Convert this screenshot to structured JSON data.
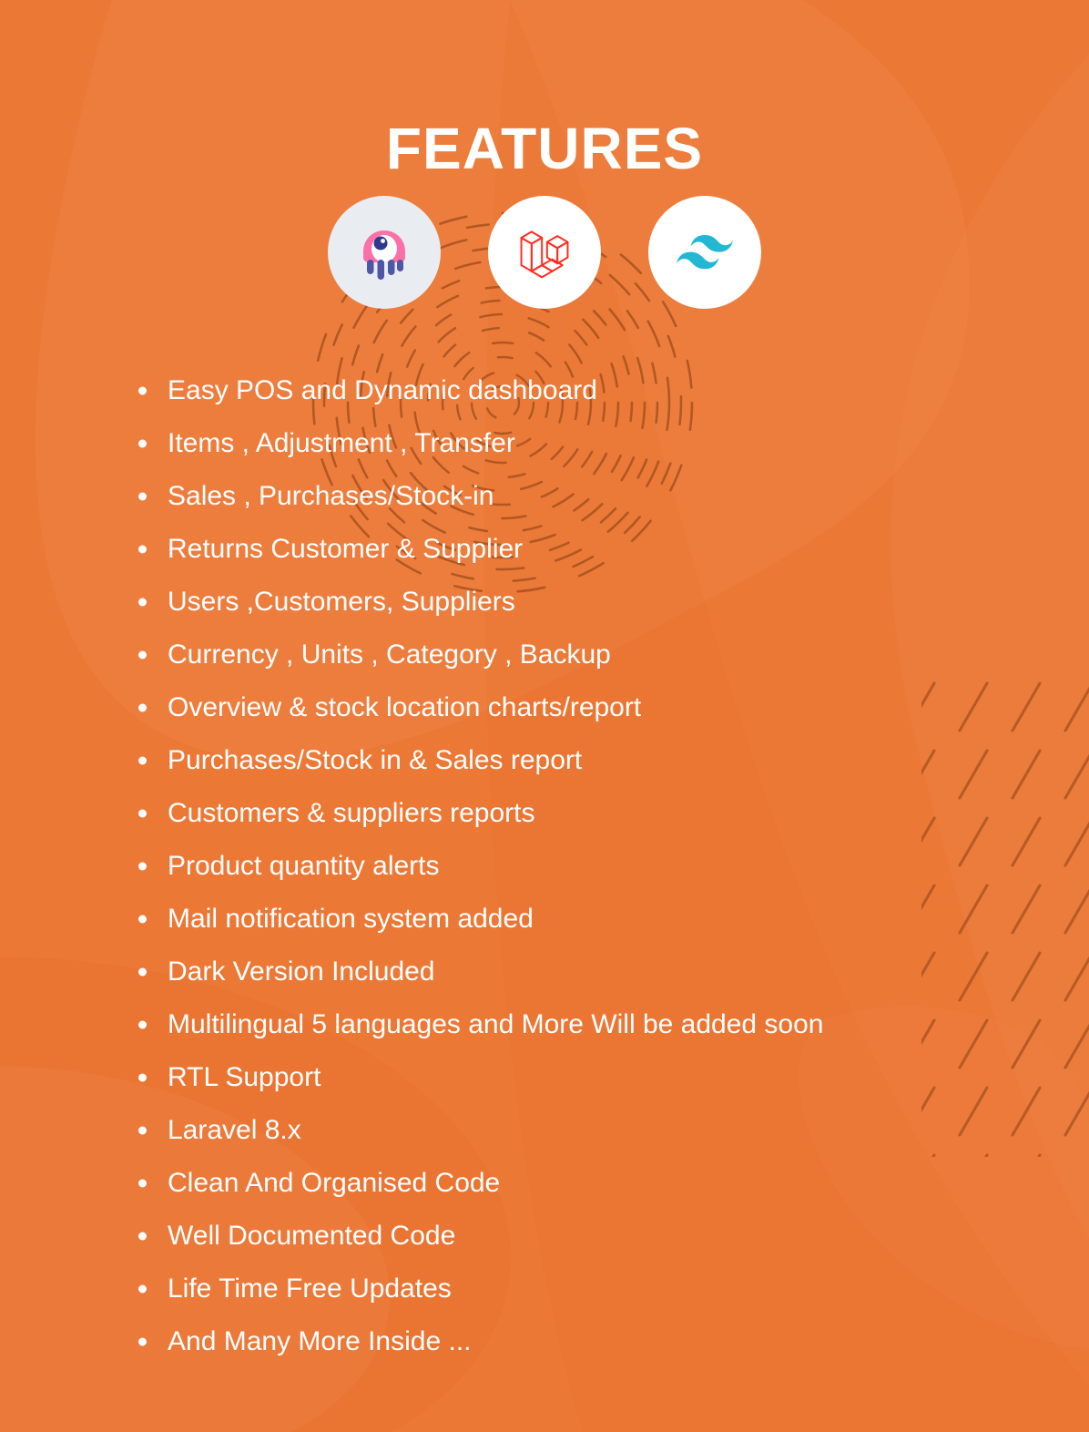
{
  "heading": {
    "title": "FEATURES"
  },
  "colors": {
    "background_base": "#EC7836",
    "blob_light": "#EE8144",
    "blob_dark": "#E87130",
    "doodle_line": "#A8521F",
    "text": "#FFFFFF",
    "livewire_pink": "#FB70A9",
    "livewire_purple": "#4E56A6",
    "laravel_red": "#FF2D20",
    "tailwind_cyan": "#22B8D4",
    "logo_circle_white": "#FFFFFF",
    "logo_circle_tint": "#E9EDF2"
  },
  "logos": [
    {
      "name": "livewire-logo",
      "label": "Livewire"
    },
    {
      "name": "laravel-logo",
      "label": "Laravel"
    },
    {
      "name": "tailwind-logo",
      "label": "Tailwind CSS"
    }
  ],
  "features": [
    "Easy POS and Dynamic dashboard",
    "Items , Adjustment , Transfer",
    " Sales , Purchases/Stock-in",
    "Returns Customer & Supplier",
    "Users ,Customers, Suppliers",
    "Currency , Units , Category , Backup",
    "Overview & stock location charts/report",
    "Purchases/Stock in & Sales report",
    "Customers & suppliers reports",
    "Product quantity alerts",
    "Mail notification system added",
    "Dark Version Included",
    "Multilingual 5 languages and More Will be added soon",
    "RTL Support",
    "Laravel 8.x",
    "Clean And Organised Code",
    "Well Documented Code",
    "Life Time Free Updates",
    "And Many More Inside ..."
  ]
}
